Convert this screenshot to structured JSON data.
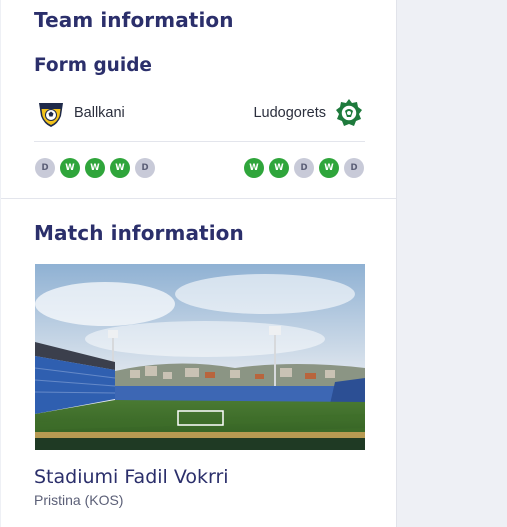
{
  "team_information": {
    "title": "Team information",
    "form_guide": {
      "title": "Form guide",
      "home": {
        "name": "Ballkani",
        "crest_icon": "ballkani-crest-icon",
        "form": [
          "D",
          "W",
          "W",
          "W",
          "D"
        ]
      },
      "away": {
        "name": "Ludogorets",
        "crest_icon": "ludogorets-crest-icon",
        "form": [
          "W",
          "W",
          "D",
          "W",
          "D"
        ]
      }
    }
  },
  "match_information": {
    "title": "Match information",
    "venue": {
      "photo": "stadium-photo",
      "name": "Stadiumi Fadil Vokrri",
      "city": "Pristina (KOS)"
    }
  },
  "colors": {
    "title": "#2b2f6b",
    "win": "#2fa53b",
    "draw": "#c8cad8",
    "background": "#eef0f5"
  }
}
